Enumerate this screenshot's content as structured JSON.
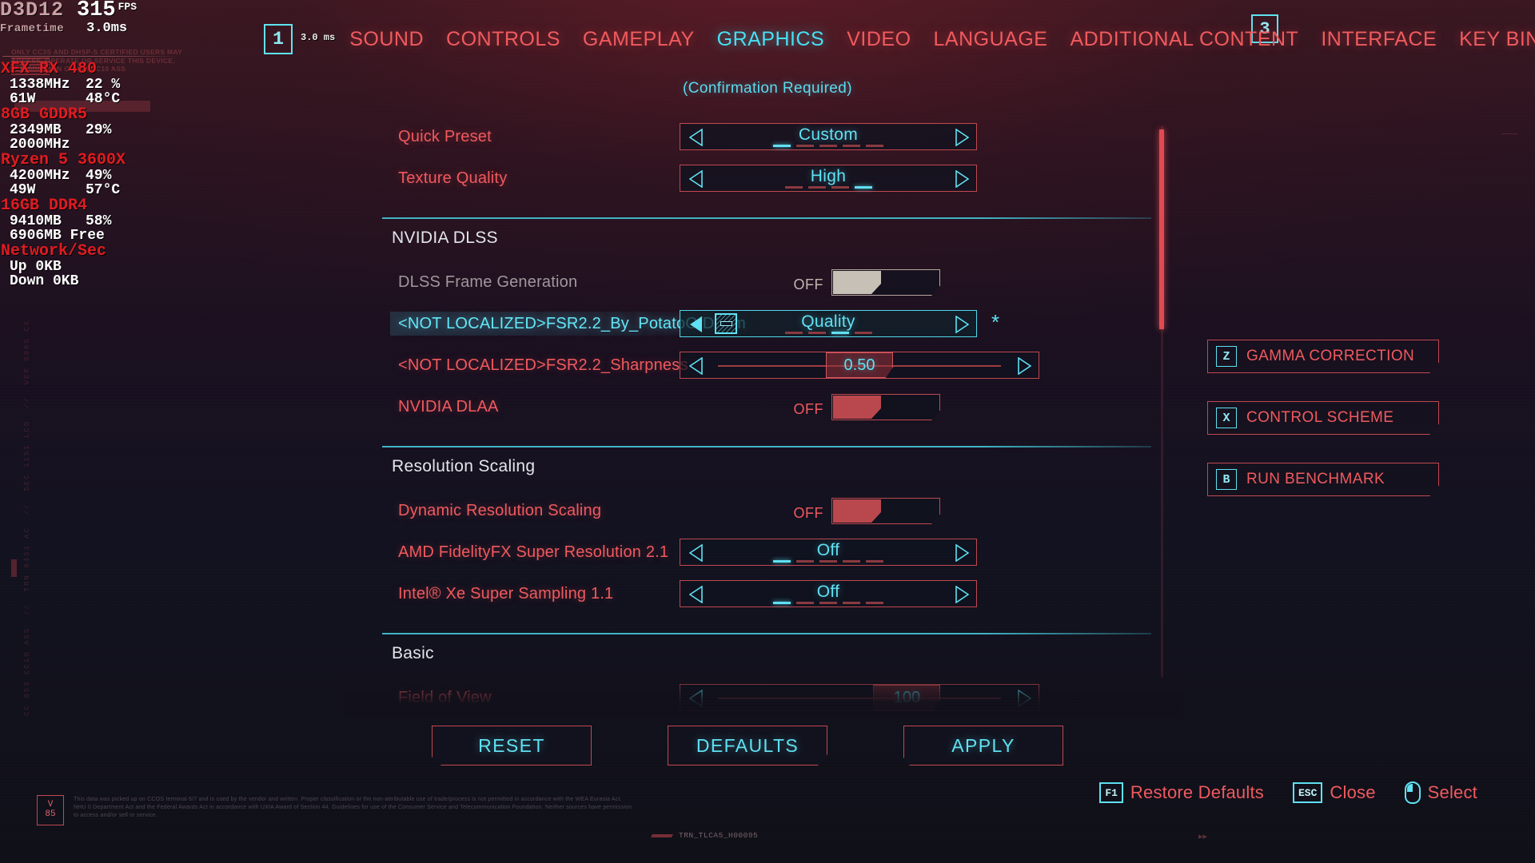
{
  "overlay": {
    "api": "D3D12",
    "fps_value": "315",
    "fps_unit": "FPS",
    "frametime_label": "Frametime",
    "frametime_value": "3.0ms",
    "frametime_nav": "3.0 ms",
    "watermark": "ONLY CC3S AND DHSP-S CERTIFIED USERS MAY ACCESS, OPERATE OR SERVICE THIS DEVICE.   JURISDICTION CC 151 CC10 ASS",
    "groups": [
      {
        "header": "XFX RX 480",
        "lines": [
          {
            "a": "1338MHz",
            "b": "22 %"
          },
          {
            "a": "61W",
            "b": "48°C"
          }
        ]
      },
      {
        "header": "8GB GDDR5",
        "lines": [
          {
            "a": "2349MB",
            "b": "29%"
          },
          {
            "a": "2000MHz",
            "b": ""
          }
        ]
      },
      {
        "header": "Ryzen 5 3600X",
        "lines": [
          {
            "a": "4200MHz",
            "b": "49%"
          },
          {
            "a": "49W",
            "b": "57°C"
          }
        ]
      },
      {
        "header": "16GB DDR4",
        "lines": [
          {
            "a": "9410MB",
            "b": "58%"
          },
          {
            "a": "6906MB Free",
            "b": ""
          }
        ]
      },
      {
        "header": "Network/Sec",
        "lines": [
          {
            "a": "Up 0KB",
            "b": ""
          },
          {
            "a": "Down 0KB",
            "b": ""
          }
        ]
      }
    ],
    "vertical_code": "CC 053 CC10 ASS  //  TRN 0451 AC  //  SEC 1151 LCD  //  VER 0085 CX"
  },
  "nav": {
    "page_left": "1",
    "page_right": "3",
    "tabs": [
      {
        "label": "SOUND",
        "active": false
      },
      {
        "label": "CONTROLS",
        "active": false
      },
      {
        "label": "GAMEPLAY",
        "active": false
      },
      {
        "label": "GRAPHICS",
        "active": true
      },
      {
        "label": "VIDEO",
        "active": false
      },
      {
        "label": "LANGUAGE",
        "active": false
      },
      {
        "label": "ADDITIONAL CONTENT",
        "active": false
      },
      {
        "label": "INTERFACE",
        "active": false
      },
      {
        "label": "KEY BINDINGS",
        "active": false
      }
    ]
  },
  "confirmation_notice": "(Confirmation Required)",
  "settings": [
    {
      "type": "stepper",
      "label": "Quick Preset",
      "value": "Custom",
      "steps": 5,
      "index": 0
    },
    {
      "type": "stepper",
      "label": "Texture Quality",
      "value": "High",
      "steps": 4,
      "index": 3
    },
    {
      "type": "section",
      "label": "NVIDIA DLSS"
    },
    {
      "type": "toggle",
      "label": "DLSS Frame Generation",
      "state": "OFF",
      "style": "grey",
      "disabled": true
    },
    {
      "type": "stepper",
      "label": "<NOT LOCALIZED>FSR2.2_By_PotatoOfDoom",
      "value": "Quality",
      "steps": 4,
      "index": 2,
      "selected": true,
      "starred": true
    },
    {
      "type": "slider",
      "label": "<NOT LOCALIZED>FSR2.2_Sharpness",
      "value": "0.50",
      "fill_pct": 50
    },
    {
      "type": "toggle",
      "label": "NVIDIA DLAA",
      "state": "OFF",
      "style": "red"
    },
    {
      "type": "section",
      "label": "Resolution Scaling"
    },
    {
      "type": "toggle",
      "label": "Dynamic Resolution Scaling",
      "state": "OFF",
      "style": "red"
    },
    {
      "type": "stepper",
      "label": "AMD FidelityFX Super Resolution 2.1",
      "value": "Off",
      "steps": 5,
      "index": 0
    },
    {
      "type": "stepper",
      "label": "Intel® Xe Super Sampling 1.1",
      "value": "Off",
      "steps": 5,
      "index": 0
    },
    {
      "type": "section",
      "label": "Basic"
    },
    {
      "type": "slider",
      "label": "Field of View",
      "value": "100",
      "fill_pct": 72
    }
  ],
  "side_buttons": [
    {
      "key": "Z",
      "label": "GAMMA CORRECTION"
    },
    {
      "key": "X",
      "label": "CONTROL SCHEME"
    },
    {
      "key": "B",
      "label": "RUN BENCHMARK"
    }
  ],
  "bottom_buttons": {
    "reset": "RESET",
    "defaults": "DEFAULTS",
    "apply": "APPLY"
  },
  "hints": [
    {
      "key": "F1",
      "label": "Restore Defaults",
      "icon": "key-icon"
    },
    {
      "key": "ESC",
      "label": "Close",
      "icon": "key-icon"
    },
    {
      "key": "",
      "label": "Select",
      "icon": "mouse-icon"
    }
  ],
  "chrome": {
    "version_badge_top": "V",
    "version_badge_bottom": "85",
    "legal": "This data was picked up on CCOS terminal 6/7 and is used by the vendor and written. Proper classification or the non-attributable use of trade/process is not permitted in accordance with the WEA Eurasia Act. NHU 0 Department Act and the Federal Awards Act in accordance with UXIA Award of Section 44. Guidelines for use of the Consumer Service and Telecommunication Foundation. Neither sources have permission to access and/or sell or service.",
    "trn_code": "TRN_TLCA5_H00095",
    "corner_tick": "——",
    "corner_tick2": "▸▸"
  },
  "colors": {
    "accent_cyan": "#5fe1f2",
    "accent_red": "#f0595e",
    "border_red": "#c0484f",
    "disabled_grey": "#bfb6b0",
    "bg": "#11101a"
  }
}
